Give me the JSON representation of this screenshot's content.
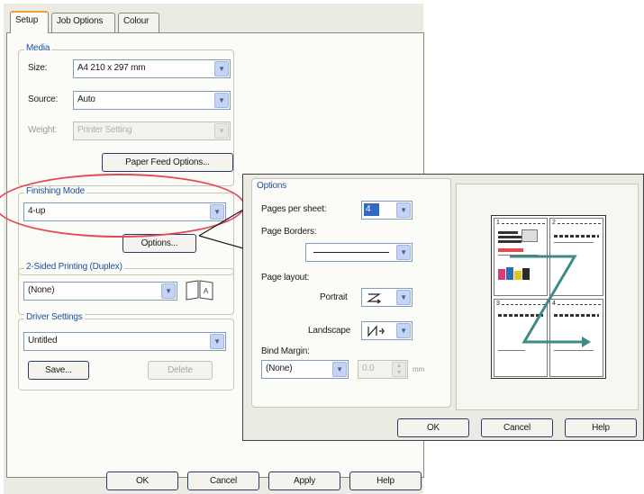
{
  "tabs": [
    "Setup",
    "Job Options",
    "Colour"
  ],
  "media": {
    "title": "Media",
    "size_label": "Size:",
    "size_value": "A4 210 x 297 mm",
    "source_label": "Source:",
    "source_value": "Auto",
    "weight_label": "Weight:",
    "weight_value": "Printer Setting",
    "paper_feed_button": "Paper Feed Options..."
  },
  "finishing": {
    "title": "Finishing Mode",
    "value": "4-up",
    "options_button": "Options..."
  },
  "duplex": {
    "title": "2-Sided Printing (Duplex)",
    "value": "(None)"
  },
  "driver": {
    "title": "Driver Settings",
    "value": "Untitled",
    "save_button": "Save...",
    "delete_button": "Delete"
  },
  "footer_buttons": [
    "OK",
    "Cancel",
    "Apply",
    "Help"
  ],
  "options_dialog": {
    "title": "Options",
    "pages_per_sheet_label": "Pages per sheet:",
    "pages_per_sheet_value": "4",
    "page_borders_label": "Page Borders:",
    "page_layout_label": "Page layout:",
    "portrait_label": "Portrait",
    "landscape_label": "Landscape",
    "bind_margin_label": "Bind Margin:",
    "bind_margin_value": "(None)",
    "margin_value": "0.0",
    "margin_unit": "mm",
    "buttons": [
      "OK",
      "Cancel",
      "Help"
    ]
  },
  "colors": {
    "callout": "#e34a55",
    "arrow": "#3e8a86",
    "group_title": "#1f4f9e",
    "selected": "#316ac5"
  }
}
